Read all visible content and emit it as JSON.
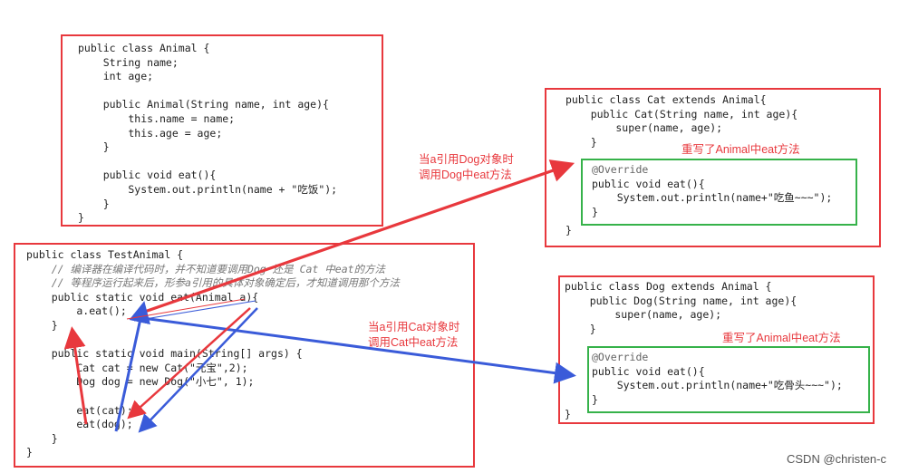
{
  "animal_box": [
    "public class Animal {",
    "    String name;",
    "    int age;",
    "",
    "    public Animal(String name, int age){",
    "        this.name = name;",
    "        this.age = age;",
    "    }",
    "",
    "    public void eat(){",
    "        System.out.println(name + \"吃饭\");",
    "    }",
    "}"
  ],
  "test_box": [
    "public class TestAnimal {",
    "    // 编译器在编译代码时，并不知道要调用Dog 还是 Cat 中eat的方法",
    "    // 等程序运行起来后，形参a引用的具体对象确定后，才知道调用那个方法",
    "    public static void eat(Animal a){",
    "        a.eat();",
    "    }",
    "",
    "    public static void main(String[] args) {",
    "        Cat cat = new Cat(\"元宝\",2);",
    "        Dog dog = new Dog(\"小七\", 1);",
    "",
    "        eat(cat);",
    "        eat(dog);",
    "    }",
    "}"
  ],
  "cat_box": {
    "header": [
      "public class Cat extends Animal{",
      "    public Cat(String name, int age){",
      "        super(name, age);",
      "    }"
    ],
    "override": [
      "@Override",
      "public void eat(){",
      "    System.out.println(name+\"吃鱼~~~\");",
      "}"
    ],
    "footer": "}"
  },
  "dog_box": {
    "header": [
      "public class Dog extends Animal {",
      "    public Dog(String name, int age){",
      "        super(name, age);",
      "    }"
    ],
    "override": [
      "@Override",
      "public void eat(){",
      "    System.out.println(name+\"吃骨头~~~\");",
      "}"
    ],
    "footer": "}"
  },
  "labels": {
    "dog_call_line1": "当a引用Dog对象时",
    "dog_call_line2": "调用Dog中eat方法",
    "cat_call_line1": "当a引用Cat对象时",
    "cat_call_line2": "调用Cat中eat方法",
    "cat_override": "重写了Animal中eat方法",
    "dog_override": "重写了Animal中eat方法"
  },
  "watermark": "CSDN @christen-c",
  "colors": {
    "red_arrow": "#e8383d",
    "blue_arrow": "#3a5bd9",
    "box_border": "#e8383d",
    "override_border": "#36b24a"
  }
}
